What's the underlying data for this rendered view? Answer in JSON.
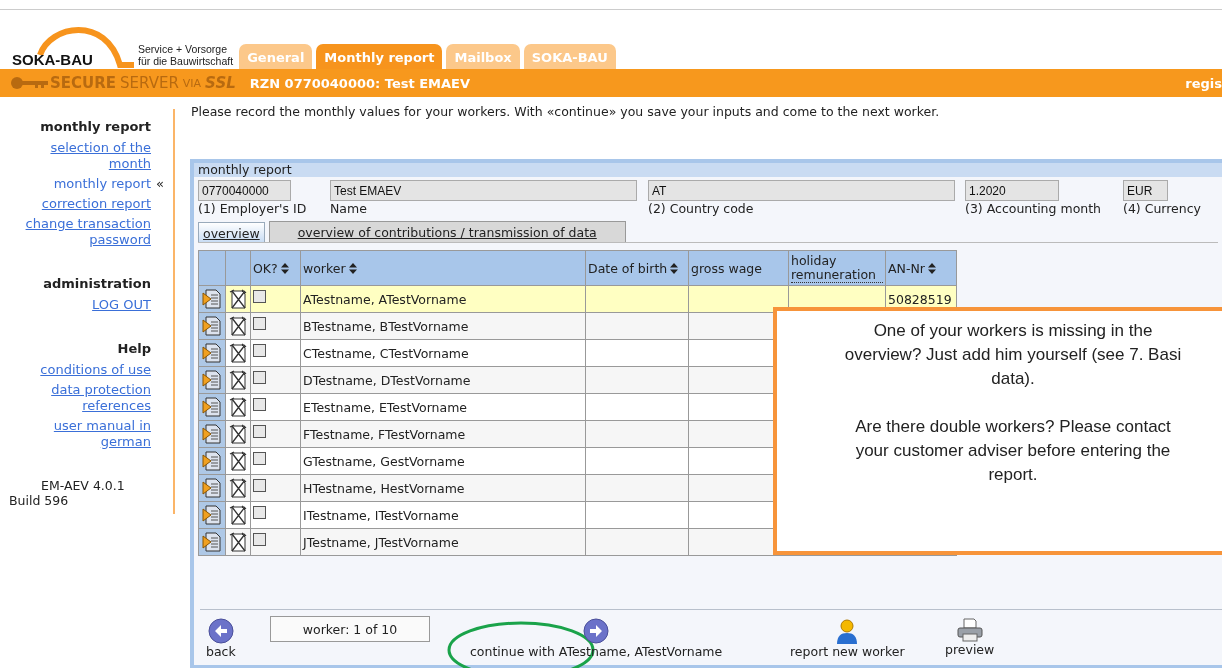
{
  "logo": {
    "name": "SOKA-BAU",
    "tagline": [
      "Service + Vorsorge",
      "für die Bauwirtschaft"
    ]
  },
  "tabs": [
    {
      "label": "General",
      "selected": false
    },
    {
      "label": "Monthly report",
      "selected": true
    },
    {
      "label": "Mailbox",
      "selected": false
    },
    {
      "label": "SOKA-BAU",
      "selected": false
    }
  ],
  "secure_bar": {
    "brand": [
      "SECURE",
      "SERVER",
      "VIA",
      "SSL"
    ],
    "title": "RZN 0770040000: Test EMAEV",
    "right_text": "regis"
  },
  "sidebar": {
    "current_marker": "«",
    "sections": [
      {
        "heading": "monthly report",
        "items": [
          {
            "label": "selection of the month",
            "selected": false
          },
          {
            "label": "monthly report",
            "selected": true
          },
          {
            "label": "correction report",
            "selected": false
          },
          {
            "label": "change transaction password",
            "selected": false
          }
        ]
      },
      {
        "heading": "administration",
        "items": [
          {
            "label": "LOG OUT",
            "selected": false
          }
        ]
      },
      {
        "heading": "Help",
        "items": [
          {
            "label": "conditions of use",
            "selected": false
          },
          {
            "label": "data protection references",
            "selected": false
          },
          {
            "label": "user manual in german",
            "selected": false
          }
        ]
      }
    ],
    "version": [
      "EM-AEV 4.0.1",
      "Build 596"
    ]
  },
  "intro": "Please record the monthly values for your workers. With «continue» you save your inputs and come to the next worker.",
  "panel": {
    "title": "monthly report",
    "fields": [
      {
        "value": "0770040000",
        "label": "(1) Employer's ID"
      },
      {
        "value": "Test EMAEV",
        "label": "Name"
      },
      {
        "value": "AT",
        "label": "(2) Country code"
      },
      {
        "value": "1.2020",
        "label": "(3) Accounting month"
      },
      {
        "value": "EUR",
        "label": "(4) Currency"
      }
    ],
    "subtabs": [
      {
        "label": "overview",
        "selected": true
      },
      {
        "label": "overview of contributions / transmission of data",
        "selected": false
      }
    ],
    "table": {
      "columns": [
        {
          "kind": "icon"
        },
        {
          "kind": "icon"
        },
        {
          "kind": "text",
          "label": "OK?",
          "sortable": true
        },
        {
          "kind": "text",
          "label": "worker",
          "sortable": true
        },
        {
          "kind": "text",
          "label": "Date of birth",
          "sortable": true
        },
        {
          "kind": "text",
          "label": "gross wage",
          "sortable": false
        },
        {
          "kind": "abbr",
          "label": "holiday remuneration",
          "sortable": false
        },
        {
          "kind": "text",
          "label": "AN-Nr",
          "sortable": true
        }
      ],
      "rows": [
        {
          "worker": "ATestname, ATestVorname",
          "ok": false,
          "an_nr": "50828519",
          "selected": true
        },
        {
          "worker": "BTestname, BTestVorname",
          "ok": false,
          "selected": false
        },
        {
          "worker": "CTestname, CTestVorname",
          "ok": false,
          "selected": false
        },
        {
          "worker": "DTestname, DTestVorname",
          "ok": false,
          "selected": false
        },
        {
          "worker": "ETestname, ETestVorname",
          "ok": false,
          "selected": false
        },
        {
          "worker": "FTestname, FTestVorname",
          "ok": false,
          "selected": false
        },
        {
          "worker": "GTestname, GestVorname",
          "ok": false,
          "selected": false
        },
        {
          "worker": "HTestname, HestVorname",
          "ok": false,
          "selected": false
        },
        {
          "worker": "ITestname, ITestVorname",
          "ok": false,
          "selected": false
        },
        {
          "worker": "JTestname, JTestVorname",
          "ok": false,
          "selected": false
        }
      ]
    },
    "callout": [
      [
        "One of your workers is missing in the",
        "overview? Just add him yourself (see 7. Basi",
        "data)."
      ],
      [
        "Are there double workers? Please contact",
        "your customer adviser before entering the",
        "report."
      ]
    ],
    "footer": {
      "back": "back",
      "counter": "worker: 1 of 10",
      "continue": "continue with ATestname, ATestVorname",
      "actions": [
        {
          "kind": "person",
          "label": "report new worker"
        },
        {
          "kind": "printer",
          "label": "preview"
        }
      ]
    }
  }
}
